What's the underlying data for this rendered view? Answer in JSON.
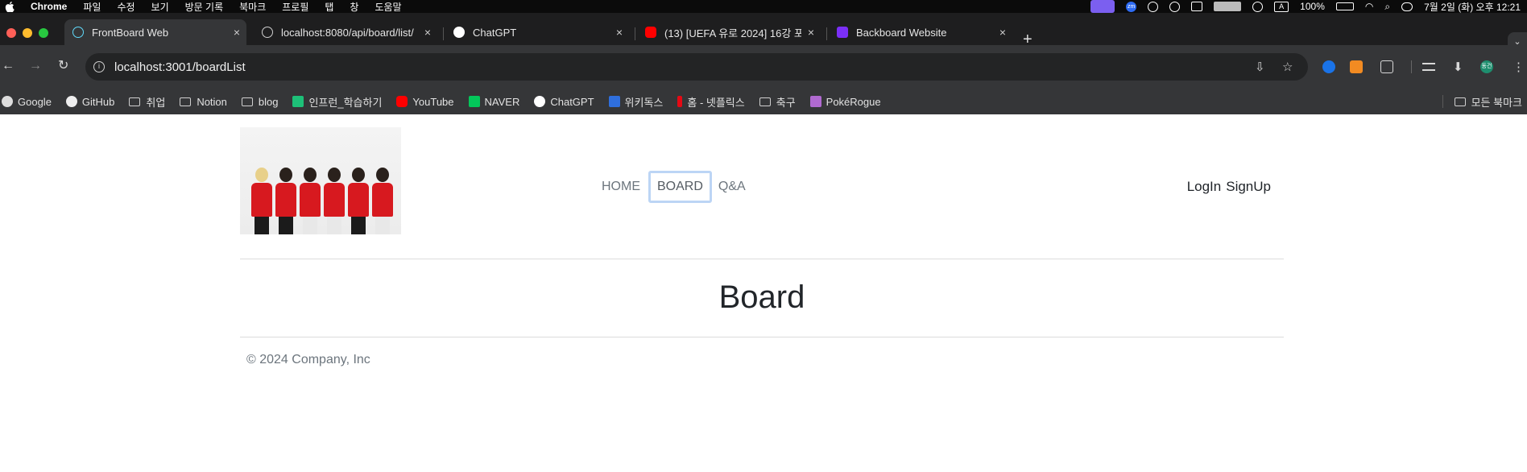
{
  "menubar": {
    "app_name": "Chrome",
    "items": [
      "파일",
      "수정",
      "보기",
      "방문 기록",
      "북마크",
      "프로필",
      "탭",
      "창",
      "도움말"
    ],
    "battery": "100%",
    "datetime": "7월 2일 (화) 오후 12:21",
    "input_indicator": "A",
    "zm_badge": "zm"
  },
  "tabs": [
    {
      "title": "FrontBoard Web",
      "close": "×",
      "active": true,
      "icon": "react-icon"
    },
    {
      "title": "localhost:8080/api/board/list/",
      "close": "×",
      "active": false,
      "icon": "globe-icon"
    },
    {
      "title": "ChatGPT",
      "close": "×",
      "active": false,
      "icon": "chatgpt-icon"
    },
    {
      "title": "(13) [UEFA 유로 2024] 16강 포",
      "close": "×",
      "active": false,
      "icon": "youtube-icon"
    },
    {
      "title": "Backboard Website",
      "close": "×",
      "active": false,
      "icon": "bootstrap-icon"
    }
  ],
  "new_tab": "+",
  "toolbar": {
    "url": "localhost:3001/boardList",
    "back": "←",
    "forward": "→",
    "reload": "↻",
    "more": "⋮",
    "install": "⇩",
    "star": "☆",
    "download": "⬇",
    "profile_initial": "동건"
  },
  "bookmarks": [
    {
      "label": "Google",
      "type": "link",
      "icon": "google-icon"
    },
    {
      "label": "GitHub",
      "type": "link",
      "icon": "github-icon"
    },
    {
      "label": "취업",
      "type": "folder",
      "icon": "folder-icon"
    },
    {
      "label": "Notion",
      "type": "folder",
      "icon": "folder-icon"
    },
    {
      "label": "blog",
      "type": "folder",
      "icon": "folder-icon"
    },
    {
      "label": "인프런_학습하기",
      "type": "link",
      "icon": "inflearn-icon"
    },
    {
      "label": "YouTube",
      "type": "link",
      "icon": "youtube-icon"
    },
    {
      "label": "NAVER",
      "type": "link",
      "icon": "naver-icon"
    },
    {
      "label": "ChatGPT",
      "type": "link",
      "icon": "chatgpt-icon"
    },
    {
      "label": "위키독스",
      "type": "link",
      "icon": "wikidocs-icon"
    },
    {
      "label": "홈 - 넷플릭스",
      "type": "link",
      "icon": "netflix-icon"
    },
    {
      "label": "축구",
      "type": "folder",
      "icon": "folder-icon"
    },
    {
      "label": "PokéRogue",
      "type": "link",
      "icon": "pokerogue-icon"
    }
  ],
  "all_bookmarks": "모든 북마크",
  "site": {
    "nav": [
      {
        "label": "HOME",
        "focused": false
      },
      {
        "label": "BOARD",
        "focused": true
      },
      {
        "label": "Q&A",
        "focused": false
      }
    ],
    "login": "LogIn",
    "signup": "SignUp",
    "page_title": "Board",
    "footer": "© 2024 Company, Inc"
  },
  "colors": {
    "tab_active": "#353638",
    "tabstrip": "#1e1e1f",
    "focus_ring": "#bcd5f5",
    "nav_text": "#6c757d"
  }
}
